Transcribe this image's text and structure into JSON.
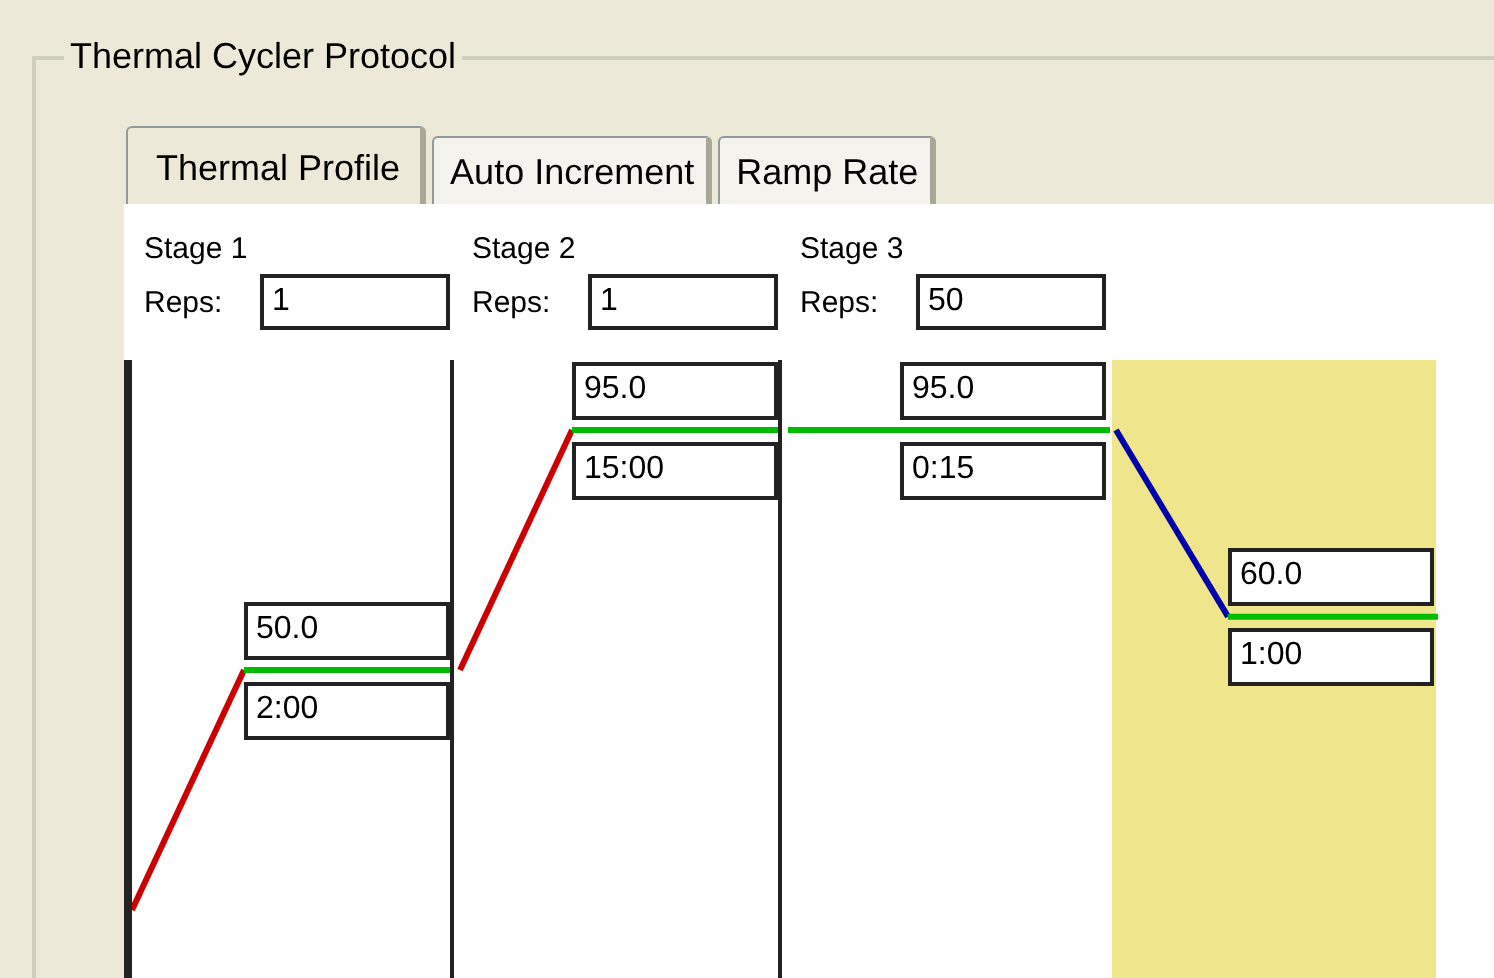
{
  "group_title": "Thermal Cycler Protocol",
  "tabs": [
    {
      "label": "Thermal Profile",
      "selected": true
    },
    {
      "label": "Auto Increment",
      "selected": false
    },
    {
      "label": "Ramp Rate",
      "selected": false
    }
  ],
  "stages": [
    {
      "label": "Stage 1",
      "reps_label": "Reps:",
      "reps": "1",
      "steps": [
        {
          "temperature": "50.0",
          "time": "2:00",
          "highlighted": false
        }
      ]
    },
    {
      "label": "Stage 2",
      "reps_label": "Reps:",
      "reps": "1",
      "steps": [
        {
          "temperature": "95.0",
          "time": "15:00",
          "highlighted": false
        }
      ]
    },
    {
      "label": "Stage 3",
      "reps_label": "Reps:",
      "reps": "50",
      "steps": [
        {
          "temperature": "95.0",
          "time": "0:15",
          "highlighted": false
        },
        {
          "temperature": "60.0",
          "time": "1:00",
          "highlighted": true
        }
      ]
    }
  ]
}
